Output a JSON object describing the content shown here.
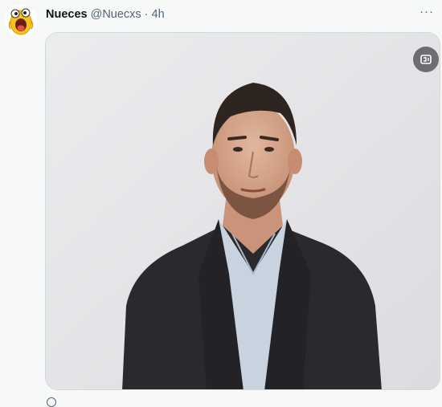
{
  "tweet": {
    "display_name": "Nueces",
    "handle": "@Nuecxs",
    "separator": "·",
    "time": "4h",
    "more_label": "···"
  },
  "media": {
    "kind": "gif",
    "icons": {
      "gif_control": "gif-toggle-icon",
      "avatar": "laughing-face-icon"
    }
  },
  "colors": {
    "background": "#f7f9f9",
    "text_primary": "#0f1419",
    "text_secondary": "#536471",
    "avatar_yellow": "#f4c21a"
  }
}
